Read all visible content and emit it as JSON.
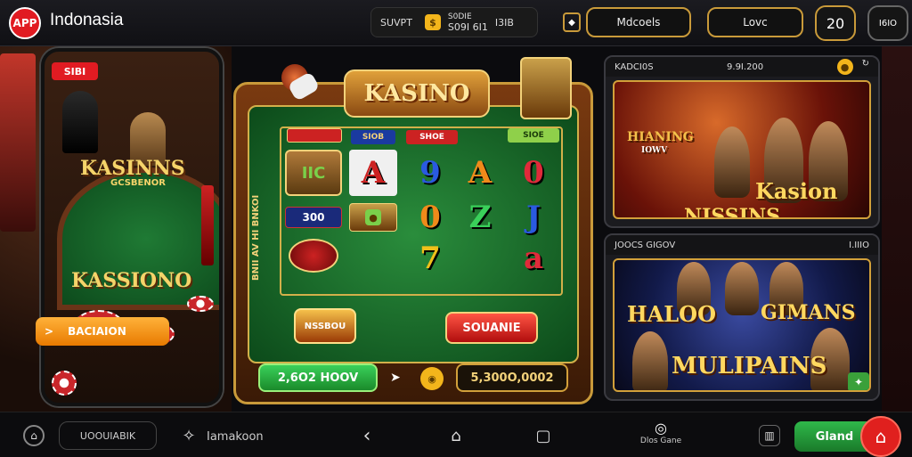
{
  "header": {
    "app_badge": "APP",
    "title": "Indonasia",
    "wallet_label": "SUVPT",
    "wallet_value": "S09I 6I1",
    "wallet_extra": "I3IB",
    "wallet_top": "S0DIE",
    "menu_label": "Mdcoels",
    "love_label": "Lovc",
    "level_value": "20",
    "corner_badge": "I6IO"
  },
  "phone": {
    "top_badge": "SIBI",
    "title_1": "KASINNS",
    "subtitle_1": "GCSBENOR",
    "title_2": "KASSIONO",
    "cta_label": "BACIAION",
    "cta_arrow": ">"
  },
  "slot": {
    "logo": "KASINO",
    "tags": [
      "SIOB",
      "SHOE",
      "SIOE"
    ],
    "left_column": [
      "IIC",
      "300",
      ""
    ],
    "symbols": [
      [
        "A",
        "9",
        "A",
        "0"
      ],
      [
        "0",
        "Z",
        "J"
      ],
      [
        "7",
        "a"
      ]
    ],
    "side_text": "BNII AV HI BNKOI",
    "badge_label": "NSSBOU",
    "spin_label": "SOUANIE",
    "balance_left": "2,6O2 HOOV",
    "balance_right": "5,300O,0002"
  },
  "card_top": {
    "header_left": "KADCI0S",
    "header_value": "9.9I.200",
    "title_small": "HIANING",
    "title_small_sub": "IOWV",
    "title_main": "Kasion",
    "title_sub": "NISSINS"
  },
  "card_bottom": {
    "header_left": "JOOCS GIGOV",
    "header_value": "I.IIIO",
    "title_1": "HALOO",
    "title_2": "GIMANS",
    "title_3": "MULIPAINS"
  },
  "bottom_nav": {
    "left_pill": "UOOUIABIK",
    "second_label": "Iamakoon",
    "right_label": "Dlos Gane",
    "grand_label": "Gland"
  },
  "colors": {
    "accent_red": "#e11b22",
    "gold": "#c99a3a",
    "felt_green": "#1f7a34",
    "cta_orange": "#ffb23a",
    "grand_green": "#2fb84a"
  }
}
